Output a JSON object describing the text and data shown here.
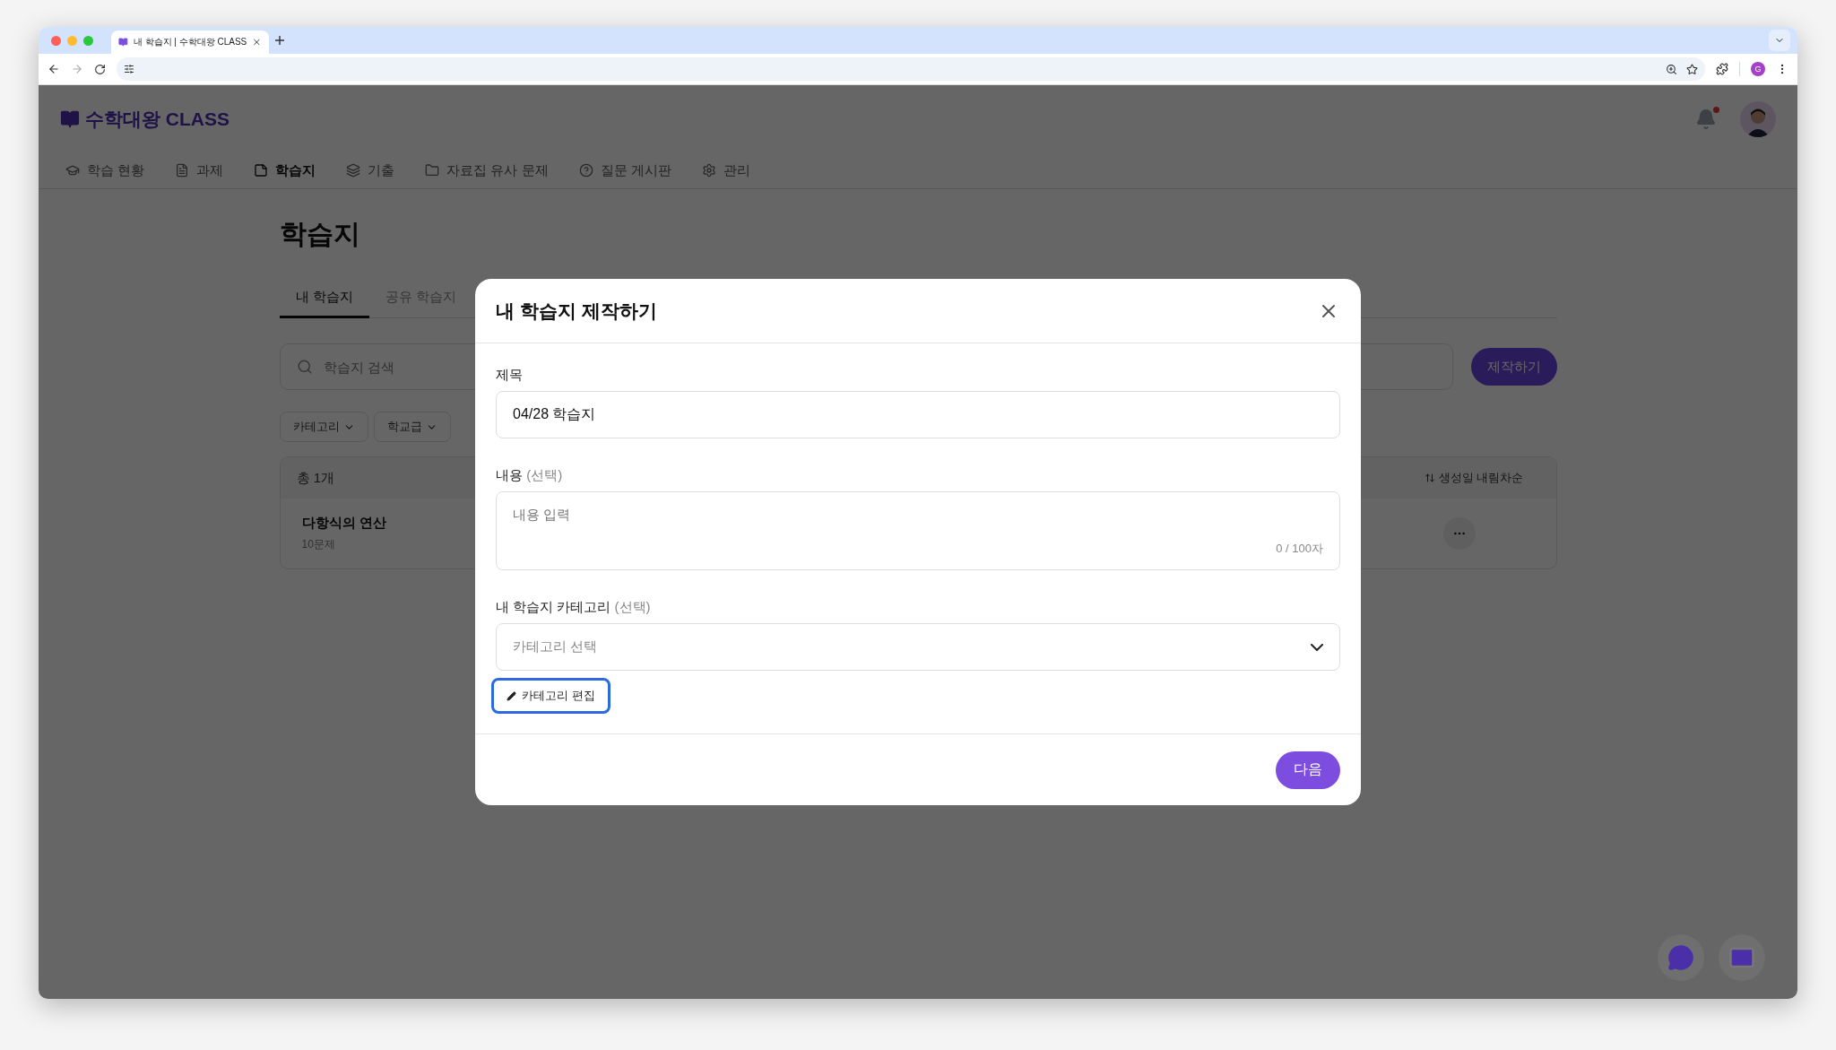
{
  "browser": {
    "tab_title": "내 학습지 | 수학대왕 CLASS",
    "profile_initial": "G"
  },
  "app": {
    "logo": "수학대왕 CLASS",
    "notification": true,
    "nav": [
      {
        "label": "학습 현황",
        "selected": false
      },
      {
        "label": "과제",
        "selected": false
      },
      {
        "label": "학습지",
        "selected": true
      },
      {
        "label": "기출",
        "selected": false
      },
      {
        "label": "자료집 유사 문제",
        "selected": false
      },
      {
        "label": "질문 게시판",
        "selected": false
      },
      {
        "label": "관리",
        "selected": false
      }
    ]
  },
  "page": {
    "title": "학습지",
    "tabs": [
      {
        "label": "내 학습지",
        "selected": true
      },
      {
        "label": "공유 학습지",
        "selected": false
      }
    ],
    "search": {
      "placeholder": "학습지 검색"
    },
    "create_button": "제작하기",
    "filters": [
      {
        "label": "카테고리"
      },
      {
        "label": "학교급"
      }
    ],
    "list": {
      "total": "총 1개",
      "sort": "생성일 내림차순",
      "items": [
        {
          "title": "다항식의 연산",
          "subtitle": "10문제"
        }
      ]
    }
  },
  "modal": {
    "title": "내 학습지 제작하기",
    "title_field": {
      "label": "제목",
      "value": "04/28 학습지"
    },
    "content_field": {
      "label": "내용",
      "optional": "(선택)",
      "placeholder": "내용 입력",
      "counter": "0 / 100자"
    },
    "category_field": {
      "label": "내 학습지 카테고리",
      "optional": "(선택)",
      "placeholder": "카테고리 선택"
    },
    "edit_button": {
      "label": "카테고리 편집",
      "focused": true
    },
    "next_button": "다음"
  }
}
